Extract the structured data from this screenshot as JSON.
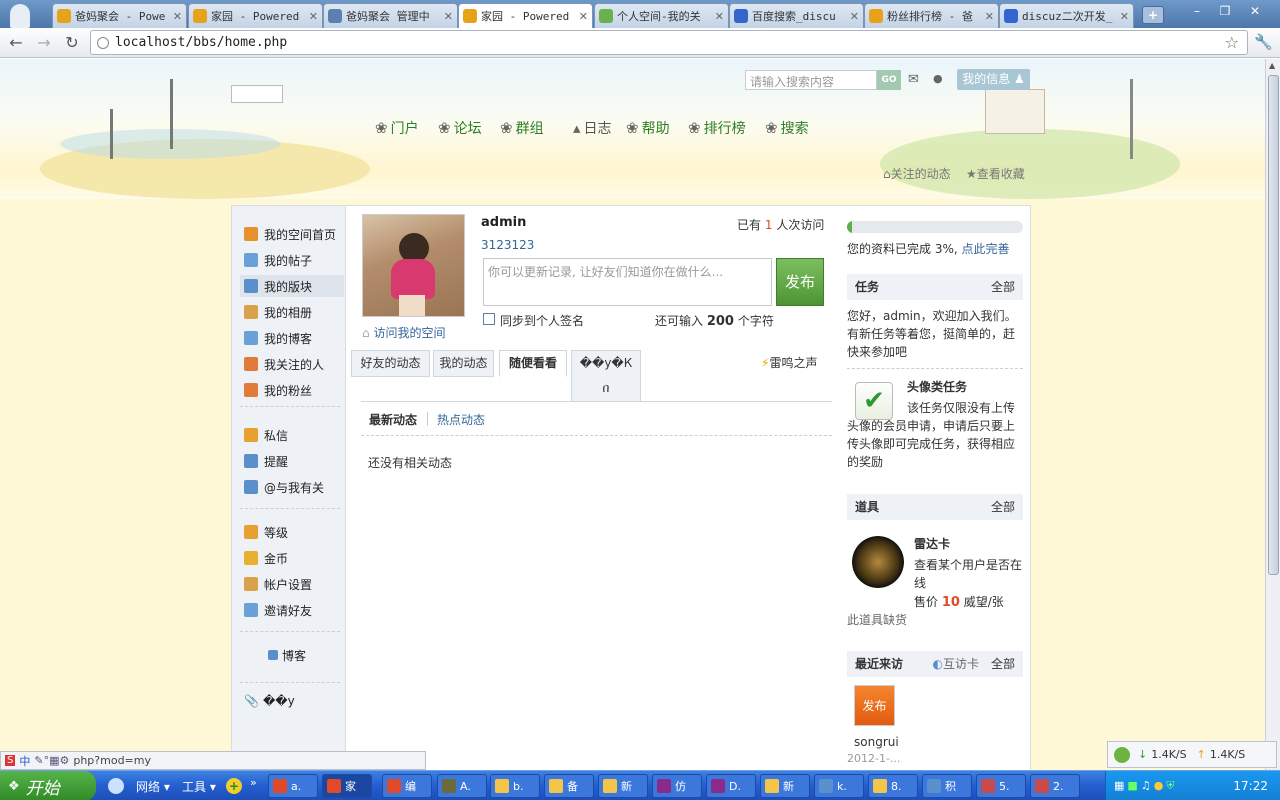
{
  "browser": {
    "tabs": [
      {
        "title": "爸妈聚会 - Powe",
        "icon": "gold",
        "color": "#e6a31a"
      },
      {
        "title": "家园 - Powered",
        "icon": "gold",
        "color": "#e6a31a"
      },
      {
        "title": "爸妈聚会 管理中",
        "icon": "globe",
        "color": "#5a7fb0"
      },
      {
        "title": "家园 - Powered",
        "icon": "gold",
        "color": "#e6a31a"
      },
      {
        "title": "个人空间-我的关",
        "icon": "iq",
        "color": "#6ab04c"
      },
      {
        "title": "百度搜索_discu",
        "icon": "baidu",
        "color": "#3366cc"
      },
      {
        "title": "粉丝排行榜 - 爸",
        "icon": "gold",
        "color": "#e6a31a"
      },
      {
        "title": "discuz二次开发_",
        "icon": "baidu",
        "color": "#3366cc"
      }
    ],
    "active_tab": 3,
    "url": "localhost/bbs/home.php",
    "status_url": "php?mod=my",
    "new_tab": "+"
  },
  "header": {
    "search_placeholder": "请输入搜索内容",
    "go": "GO",
    "my_info": "我的信息",
    "nav": [
      "门户",
      "论坛",
      "群组",
      "日志",
      "帮助",
      "排行榜",
      "搜索"
    ],
    "links": [
      "关注的动态",
      "查看收藏"
    ]
  },
  "sidebar": {
    "group1": [
      "我的空间首页",
      "我的帖子",
      "我的版块",
      "我的相册",
      "我的博客",
      "我关注的人",
      "我的粉丝"
    ],
    "group2": [
      "私信",
      "提醒",
      "@与我有关"
    ],
    "group3": [
      "等级",
      "金币",
      "帐户设置",
      "邀请好友"
    ],
    "blog": "博客",
    "bottom": "��y"
  },
  "profile": {
    "name": "admin",
    "sig": "3123123",
    "visits_prefix": "已有",
    "visits": "1",
    "visits_suffix": "人次访问",
    "status_placeholder": "你可以更新记录, 让好友们知道你在做什么...",
    "publish": "发布",
    "sync_label": "同步到个人签名",
    "remain_prefix": "还可输入",
    "remain": "200",
    "remain_suffix": "个字符",
    "visit_space": "访问我的空间"
  },
  "feed": {
    "tabs": [
      "好友的动态",
      "我的动态",
      "随便看看",
      "��у�К\nበ"
    ],
    "thunder": "雷鸣之声",
    "subtabs": [
      "最新动态",
      "热点动态"
    ],
    "empty": "还没有相关动态"
  },
  "right": {
    "progress": 0.03,
    "complete_text": "您的资料已完成 3%,",
    "complete_link": "点此完善",
    "task_title": "任务",
    "all": "全部",
    "task_text": "您好，admin，欢迎加入我们。有新任务等着您，挺简单的，赶快来参加吧",
    "task_name": "头像类任务",
    "task_desc": "该任务仅限没有上传头像的会员申请，申请后只要上传头像即可完成任务，获得相应的奖励",
    "prop_title": "道具",
    "prop_name": "雷达卡",
    "prop_desc": "查看某个用户是否在线",
    "price_prefix": "售价",
    "price": "10",
    "price_suffix": "威望/张",
    "out": "此道具缺货",
    "recent_title": "最近来访",
    "card": "互访卡",
    "visitor_img": "发布",
    "visitor": "songrui",
    "visitor_date": "2012-1-..."
  },
  "taskbar": {
    "start": "开始",
    "items": [
      "网络",
      "工具"
    ],
    "tasks": [
      "a.",
      "家",
      "编",
      "A.",
      "b.",
      "备",
      "新",
      "仿",
      "D.",
      "新",
      "k.",
      "8.",
      "积",
      "5.",
      "2."
    ],
    "time": "17:22",
    "down": "1.4K/S",
    "up": "1.4K/S"
  }
}
